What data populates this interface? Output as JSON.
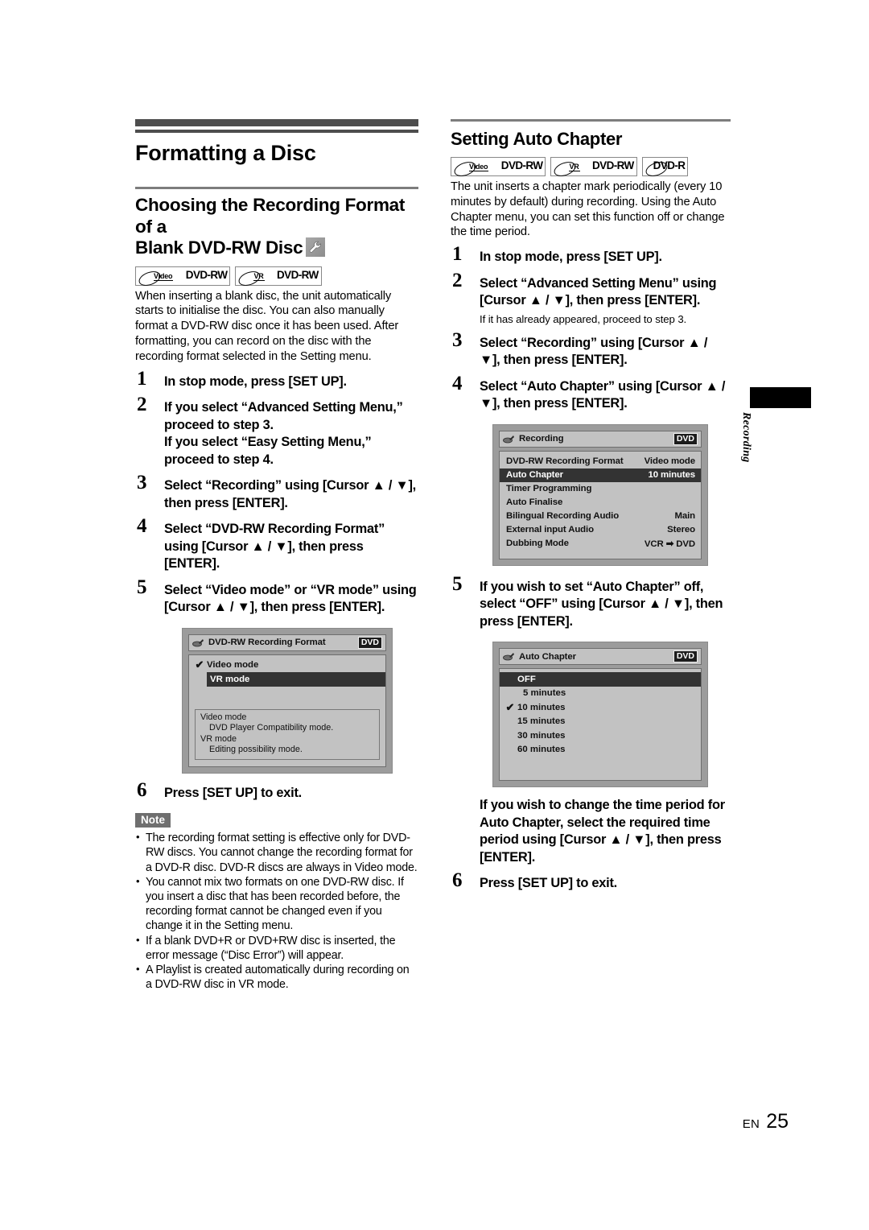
{
  "page": {
    "footer_prefix": "EN",
    "footer_page": "25",
    "side_tab_label": "Recording"
  },
  "left": {
    "doc_title": "Formatting a Disc",
    "section_title_line1": "Choosing the Recording Format of a",
    "section_title_line2": "Blank DVD-RW Disc",
    "wrench_icon": "wrench-icon",
    "logos": [
      {
        "top": "Video",
        "main": "DVD-RW"
      },
      {
        "top": "VR",
        "main": "DVD-RW"
      }
    ],
    "intro": "When inserting a blank disc, the unit automatically starts to initialise the disc. You can also manually format a DVD-RW disc once it has been used. After formatting, you can record on the disc with the recording format selected in the Setting menu.",
    "steps": [
      {
        "num": "1",
        "text": "In stop mode, press [SET UP]."
      },
      {
        "num": "2",
        "text": "If you select “Advanced Setting Menu,” proceed to step 3.\nIf you select “Easy Setting Menu,” proceed to step 4."
      },
      {
        "num": "3",
        "text": "Select “Recording” using [Cursor ▲ / ▼], then press [ENTER]."
      },
      {
        "num": "4",
        "text": "Select “DVD-RW Recording Format” using [Cursor ▲ / ▼], then press [ENTER]."
      },
      {
        "num": "5",
        "text": "Select “Video mode” or “VR mode” using [Cursor ▲ / ▼], then press [ENTER]."
      }
    ],
    "osd": {
      "title": "DVD-RW Recording Format",
      "badge": "DVD",
      "options": [
        {
          "label": "Video mode",
          "checked": true,
          "selected": false
        },
        {
          "label": "VR mode",
          "checked": false,
          "selected": true
        }
      ],
      "hint": [
        {
          "text": "Video mode",
          "indent": false
        },
        {
          "text": "DVD Player Compatibility mode.",
          "indent": true
        },
        {
          "text": "VR mode",
          "indent": false
        },
        {
          "text": "Editing possibility mode.",
          "indent": true
        }
      ]
    },
    "step_exit": {
      "num": "6",
      "text": "Press [SET UP] to exit."
    },
    "note_label": "Note",
    "notes": [
      "The recording format setting is effective only for DVD-RW discs. You cannot change the recording format for a DVD-R disc. DVD-R discs are always in Video mode.",
      "You cannot mix two formats on one DVD-RW disc. If you insert a disc that has been recorded before, the recording format cannot be changed even if you change it in the Setting menu.",
      "If a blank DVD+R or DVD+RW disc is inserted, the error message (“Disc Error”) will appear.",
      "A Playlist is created automatically during recording on a DVD-RW disc in VR mode."
    ]
  },
  "right": {
    "section_title": "Setting Auto Chapter",
    "logos": [
      {
        "top": "Video",
        "main": "DVD-RW"
      },
      {
        "top": "VR",
        "main": "DVD-RW"
      },
      {
        "top": "",
        "main": "DVD-R"
      }
    ],
    "intro": "The unit inserts a chapter mark periodically (every 10 minutes by default) during recording. Using the Auto Chapter menu, you can set this function off or change the time period.",
    "steps_a": [
      {
        "num": "1",
        "text": "In stop mode, press [SET UP]."
      },
      {
        "num": "2",
        "text": "Select “Advanced Setting Menu” using [Cursor ▲ / ▼], then press [ENTER]."
      }
    ],
    "substep_note": "If it has already appeared, proceed to step 3.",
    "steps_b": [
      {
        "num": "3",
        "text": "Select “Recording” using [Cursor ▲ / ▼], then press [ENTER]."
      },
      {
        "num": "4",
        "text": "Select “Auto Chapter” using [Cursor ▲ / ▼], then press [ENTER]."
      }
    ],
    "osd_recording": {
      "title": "Recording",
      "badge": "DVD",
      "rows": [
        {
          "label": "DVD-RW Recording Format",
          "value": "Video mode",
          "selected": false
        },
        {
          "label": "Auto Chapter",
          "value": "10 minutes",
          "selected": true
        },
        {
          "label": "Timer Programming",
          "value": "",
          "selected": false
        },
        {
          "label": "Auto Finalise",
          "value": "",
          "selected": false
        },
        {
          "label": "Bilingual Recording Audio",
          "value": "Main",
          "selected": false
        },
        {
          "label": "External input Audio",
          "value": "Stereo",
          "selected": false
        },
        {
          "label": "Dubbing Mode",
          "value": "VCR ➡ DVD",
          "selected": false
        }
      ]
    },
    "step5": {
      "num": "5",
      "text": "If you wish to set “Auto Chapter” off, select “OFF” using [Cursor ▲ / ▼], then press [ENTER]."
    },
    "osd_chapter": {
      "title": "Auto Chapter",
      "badge": "DVD",
      "options": [
        {
          "label": "OFF",
          "checked": false,
          "selected": true
        },
        {
          "label": "5 minutes",
          "checked": false,
          "selected": false
        },
        {
          "label": "10 minutes",
          "checked": true,
          "selected": false
        },
        {
          "label": "15 minutes",
          "checked": false,
          "selected": false
        },
        {
          "label": "30 minutes",
          "checked": false,
          "selected": false
        },
        {
          "label": "60 minutes",
          "checked": false,
          "selected": false
        }
      ]
    },
    "para_change": "If you wish to change the time period for Auto Chapter, select the required time period using [Cursor ▲ / ▼], then press [ENTER].",
    "step_exit": {
      "num": "6",
      "text": "Press [SET UP] to exit."
    }
  }
}
